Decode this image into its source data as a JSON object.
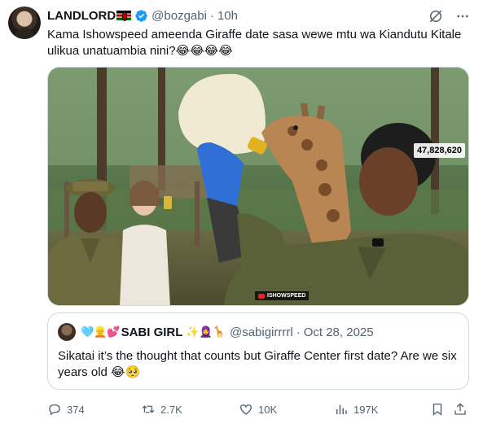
{
  "author": {
    "display_name": "LANDLORD",
    "flag_icon": "kenya-flag-icon",
    "verified_icon": "verified-badge-icon",
    "handle": "@bozgabi",
    "separator": "·",
    "time": "10h"
  },
  "top_icons": [
    "grok-icon",
    "more-icon"
  ],
  "tweet_text": "Kama Ishowspeed ameenda Giraffe date sasa wewe mtu wa Kiandutu Kitale ulikua unatuambia nini?😂😂😂😂",
  "media": {
    "view_count": "47,828,620",
    "watermark": "ISHOWSPEED"
  },
  "quote": {
    "name_prefix_emojis": "🩵👱💕",
    "display_name": "SABI GIRL",
    "name_suffix_emojis": "✨🧕🦒",
    "handle": "@sabigirrrrl",
    "separator": "·",
    "time": "Oct 28, 2025",
    "text": "Sikatai it’s the thought that counts but Giraffe Center first date? Are we six years old 😂🥺"
  },
  "actions": {
    "replies": "374",
    "reposts": "2.7K",
    "likes": "10K",
    "views": "197K"
  },
  "colors": {
    "text": "#0f1419",
    "secondary": "#536471",
    "verified": "#1d9bf0",
    "border": "#cfd9de"
  }
}
